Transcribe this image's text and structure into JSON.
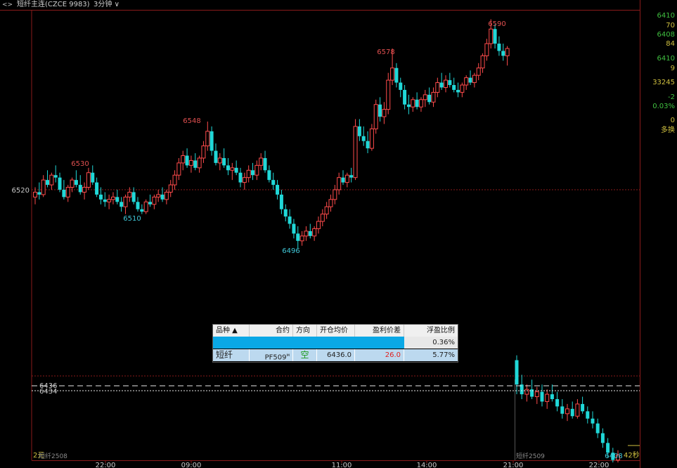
{
  "topbar": {
    "icon": "swap-arrows-icon",
    "title": "短纤主连(CZCE 9983)",
    "period": "3分钟"
  },
  "colors": {
    "up": "#ff4b4b",
    "down": "#20d8d8",
    "label_up": "#e05050",
    "label_down": "#40c8d8",
    "grid": "#8a1a1a",
    "side_green": "#40c040",
    "side_yellow": "#d0c040",
    "side_red": "#e04040"
  },
  "chart_data": {
    "type": "candlestick",
    "symbol": "短纤主连",
    "x_ticks": [
      "22:00",
      "09:00",
      "11:00",
      "14:00",
      "21:00",
      "22:00"
    ],
    "y_label_left": "6520",
    "price_annotations": [
      "6530",
      "6510",
      "6548",
      "6496",
      "6578",
      "6590",
      "6408"
    ],
    "reference_lines": [
      "6436",
      "6434"
    ],
    "segment_labels": [
      "短纤2508",
      "短纤2509"
    ],
    "bottom_left_badge": "2元",
    "countdown": "42秒",
    "series": [
      {
        "segment": "短纤2508",
        "ohlc": [
          [
            6517,
            6521,
            6514,
            6519
          ],
          [
            6519,
            6523,
            6516,
            6518
          ],
          [
            6518,
            6526,
            6517,
            6524
          ],
          [
            6524,
            6528,
            6521,
            6522
          ],
          [
            6522,
            6527,
            6520,
            6526
          ],
          [
            6526,
            6530,
            6523,
            6525
          ],
          [
            6525,
            6527,
            6519,
            6520
          ],
          [
            6520,
            6524,
            6516,
            6517
          ],
          [
            6517,
            6522,
            6515,
            6521
          ],
          [
            6521,
            6525,
            6519,
            6524
          ],
          [
            6524,
            6528,
            6521,
            6522
          ],
          [
            6522,
            6526,
            6518,
            6519
          ],
          [
            6519,
            6523,
            6516,
            6521
          ],
          [
            6521,
            6529,
            6520,
            6527
          ],
          [
            6527,
            6530,
            6522,
            6523
          ],
          [
            6523,
            6525,
            6517,
            6518
          ],
          [
            6518,
            6521,
            6514,
            6516
          ],
          [
            6516,
            6519,
            6513,
            6515
          ],
          [
            6515,
            6518,
            6512,
            6516
          ],
          [
            6516,
            6519,
            6514,
            6517
          ],
          [
            6517,
            6520,
            6514,
            6515
          ],
          [
            6515,
            6517,
            6511,
            6513
          ],
          [
            6513,
            6518,
            6510,
            6517
          ],
          [
            6517,
            6521,
            6515,
            6519
          ],
          [
            6519,
            6521,
            6514,
            6515
          ],
          [
            6515,
            6517,
            6511,
            6512
          ],
          [
            6512,
            6514,
            6510,
            6511
          ],
          [
            6511,
            6516,
            6510,
            6515
          ],
          [
            6515,
            6518,
            6513,
            6514
          ],
          [
            6514,
            6518,
            6512,
            6517
          ],
          [
            6517,
            6520,
            6515,
            6518
          ],
          [
            6518,
            6521,
            6515,
            6516
          ],
          [
            6516,
            6520,
            6514,
            6519
          ],
          [
            6519,
            6524,
            6517,
            6522
          ],
          [
            6522,
            6528,
            6520,
            6526
          ],
          [
            6526,
            6533,
            6524,
            6531
          ],
          [
            6531,
            6536,
            6528,
            6534
          ],
          [
            6534,
            6537,
            6529,
            6530
          ],
          [
            6530,
            6534,
            6527,
            6532
          ],
          [
            6532,
            6535,
            6528,
            6529
          ],
          [
            6529,
            6534,
            6527,
            6533
          ],
          [
            6533,
            6540,
            6531,
            6538
          ],
          [
            6538,
            6548,
            6536,
            6544
          ],
          [
            6544,
            6546,
            6534,
            6536
          ],
          [
            6536,
            6539,
            6530,
            6531
          ],
          [
            6531,
            6535,
            6528,
            6533
          ],
          [
            6533,
            6537,
            6529,
            6530
          ],
          [
            6530,
            6533,
            6526,
            6528
          ],
          [
            6528,
            6531,
            6524,
            6529
          ],
          [
            6529,
            6532,
            6526,
            6527
          ],
          [
            6527,
            6529,
            6521,
            6523
          ],
          [
            6523,
            6527,
            6520,
            6525
          ],
          [
            6525,
            6530,
            6523,
            6528
          ],
          [
            6528,
            6531,
            6524,
            6526
          ],
          [
            6526,
            6532,
            6524,
            6530
          ],
          [
            6530,
            6535,
            6528,
            6533
          ],
          [
            6533,
            6536,
            6527,
            6528
          ],
          [
            6528,
            6530,
            6523,
            6524
          ],
          [
            6524,
            6527,
            6520,
            6522
          ],
          [
            6522,
            6524,
            6516,
            6518
          ],
          [
            6518,
            6520,
            6510,
            6512
          ],
          [
            6512,
            6514,
            6507,
            6509
          ],
          [
            6509,
            6512,
            6504,
            6506
          ],
          [
            6506,
            6508,
            6500,
            6502
          ],
          [
            6502,
            6505,
            6496,
            6499
          ],
          [
            6499,
            6503,
            6497,
            6501
          ],
          [
            6501,
            6505,
            6499,
            6503
          ],
          [
            6503,
            6506,
            6500,
            6501
          ],
          [
            6501,
            6505,
            6499,
            6504
          ],
          [
            6504,
            6509,
            6502,
            6507
          ],
          [
            6507,
            6512,
            6505,
            6510
          ],
          [
            6510,
            6515,
            6508,
            6513
          ],
          [
            6513,
            6518,
            6511,
            6516
          ],
          [
            6516,
            6522,
            6514,
            6520
          ],
          [
            6520,
            6527,
            6518,
            6525
          ],
          [
            6525,
            6528,
            6522,
            6523
          ],
          [
            6523,
            6527,
            6521,
            6526
          ],
          [
            6526,
            6529,
            6523,
            6525
          ],
          [
            6525,
            6549,
            6524,
            6546
          ],
          [
            6546,
            6549,
            6540,
            6542
          ],
          [
            6542,
            6546,
            6538,
            6540
          ],
          [
            6540,
            6544,
            6535,
            6537
          ],
          [
            6537,
            6547,
            6536,
            6545
          ],
          [
            6545,
            6557,
            6543,
            6555
          ],
          [
            6555,
            6558,
            6548,
            6550
          ],
          [
            6550,
            6556,
            6547,
            6553
          ],
          [
            6553,
            6568,
            6551,
            6565
          ],
          [
            6565,
            6578,
            6563,
            6570
          ],
          [
            6570,
            6572,
            6562,
            6564
          ],
          [
            6564,
            6566,
            6558,
            6561
          ],
          [
            6561,
            6563,
            6553,
            6555
          ],
          [
            6555,
            6559,
            6551,
            6554
          ],
          [
            6554,
            6558,
            6552,
            6557
          ],
          [
            6557,
            6560,
            6553,
            6554
          ],
          [
            6554,
            6558,
            6552,
            6557
          ],
          [
            6557,
            6561,
            6554,
            6559
          ],
          [
            6559,
            6562,
            6555,
            6556
          ],
          [
            6556,
            6562,
            6554,
            6560
          ],
          [
            6560,
            6566,
            6558,
            6564
          ],
          [
            6564,
            6568,
            6561,
            6562
          ],
          [
            6562,
            6567,
            6560,
            6565
          ],
          [
            6565,
            6568,
            6562,
            6563
          ],
          [
            6563,
            6566,
            6560,
            6561
          ],
          [
            6561,
            6564,
            6558,
            6560
          ],
          [
            6560,
            6564,
            6558,
            6563
          ],
          [
            6563,
            6567,
            6561,
            6566
          ],
          [
            6566,
            6569,
            6563,
            6564
          ],
          [
            6564,
            6568,
            6562,
            6567
          ],
          [
            6567,
            6572,
            6565,
            6570
          ],
          [
            6570,
            6576,
            6568,
            6575
          ],
          [
            6575,
            6582,
            6573,
            6580
          ],
          [
            6580,
            6590,
            6578,
            6586
          ],
          [
            6586,
            6588,
            6578,
            6580
          ],
          [
            6580,
            6583,
            6575,
            6577
          ],
          [
            6577,
            6580,
            6573,
            6575
          ],
          [
            6575,
            6579,
            6571,
            6578
          ]
        ]
      },
      {
        "segment": "短纤2509",
        "ohlc": [
          [
            6450,
            6452,
            6436,
            6440
          ],
          [
            6440,
            6444,
            6434,
            6436
          ],
          [
            6436,
            6440,
            6433,
            6438
          ],
          [
            6438,
            6442,
            6434,
            6435
          ],
          [
            6435,
            6439,
            6432,
            6437
          ],
          [
            6437,
            6440,
            6431,
            6433
          ],
          [
            6433,
            6438,
            6430,
            6436
          ],
          [
            6436,
            6440,
            6433,
            6434
          ],
          [
            6434,
            6437,
            6429,
            6431
          ],
          [
            6431,
            6434,
            6426,
            6428
          ],
          [
            6428,
            6432,
            6425,
            6430
          ],
          [
            6430,
            6433,
            6426,
            6427
          ],
          [
            6427,
            6434,
            6426,
            6432
          ],
          [
            6432,
            6435,
            6428,
            6429
          ],
          [
            6429,
            6431,
            6424,
            6426
          ],
          [
            6426,
            6429,
            6422,
            6424
          ],
          [
            6424,
            6426,
            6418,
            6420
          ],
          [
            6420,
            6422,
            6414,
            6416
          ],
          [
            6416,
            6418,
            6410,
            6412
          ],
          [
            6412,
            6414,
            6408,
            6409
          ],
          [
            6409,
            6413,
            6408,
            6411
          ]
        ]
      }
    ]
  },
  "side": {
    "items": [
      {
        "text": "6410",
        "color": "green"
      },
      {
        "text": "70",
        "color": "yellow"
      },
      {
        "text": "6408",
        "color": "green"
      },
      {
        "text": "84",
        "color": "yellow"
      },
      {
        "text": "6410",
        "color": "green"
      },
      {
        "text": "9",
        "color": "yellow"
      },
      {
        "text": "33245",
        "color": "yellow"
      },
      {
        "text": "-2",
        "color": "green"
      },
      {
        "text": "0.03%",
        "color": "green"
      },
      {
        "text": "0",
        "color": "yellow"
      },
      {
        "text": "多换",
        "color": "yellow"
      }
    ]
  },
  "panel": {
    "headers": [
      "品种 ▲",
      "合约",
      "方向",
      "开仓均价",
      "盈利价差",
      "浮盈比例"
    ],
    "total_ratio": "0.36%",
    "row": {
      "name": "短纤",
      "contract": "PF509",
      "contract_mark": "м",
      "direction": "空",
      "open_price": "6436.0",
      "profit_diff": "26.0",
      "ratio": "5.77%"
    }
  }
}
